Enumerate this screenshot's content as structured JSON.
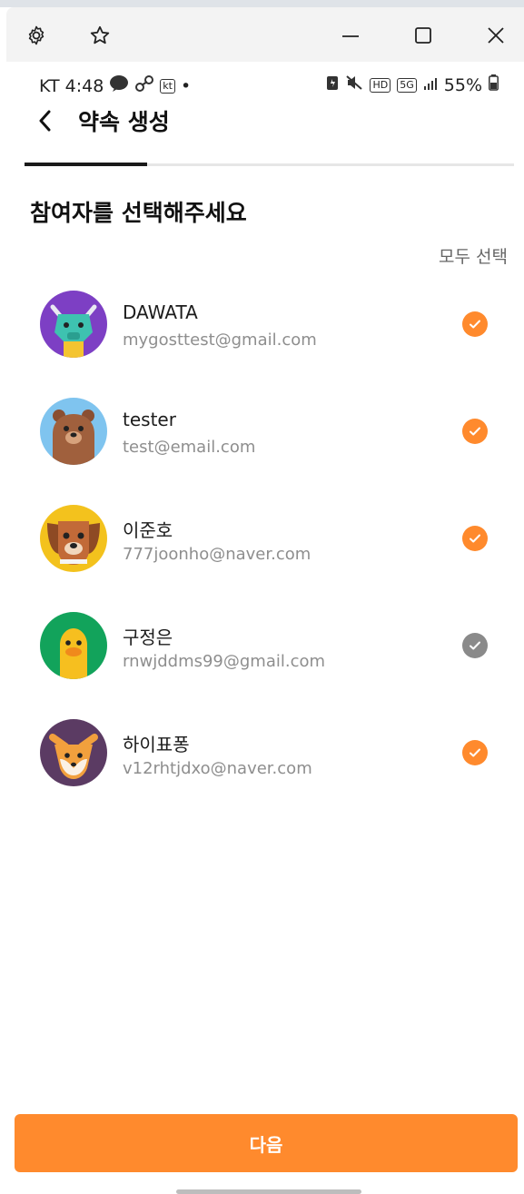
{
  "status": {
    "carrier_time": "KT 4:48",
    "kt_badge": "kt",
    "dot": "•",
    "hd": "HD",
    "net": "5G",
    "battery": "55%"
  },
  "header": {
    "title": "약속 생성"
  },
  "progress": {
    "fraction": 0.25
  },
  "heading": "참여자를 선택해주세요",
  "select_all": "모두 선택",
  "participants": [
    {
      "name": "DAWATA",
      "email": "mygosttest@gmail.com",
      "checked": true
    },
    {
      "name": "tester",
      "email": "test@email.com",
      "checked": true
    },
    {
      "name": "이준호",
      "email": "777joonho@naver.com",
      "checked": true
    },
    {
      "name": "구정은",
      "email": "rnwjddms99@gmail.com",
      "checked": false
    },
    {
      "name": "하이표퐁",
      "email": "v12rhtjdxo@naver.com",
      "checked": true
    }
  ],
  "next_button": "다음",
  "colors": {
    "accent": "#ff8a2d",
    "check_on": "#ff8a2d",
    "check_off": "#8a8a8a"
  }
}
